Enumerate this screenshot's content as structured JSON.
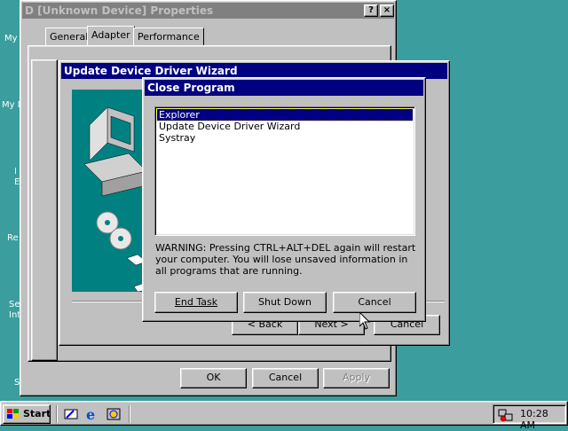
{
  "desktop": {
    "icon_labels": [
      "My",
      "My D",
      "I\nE",
      "Re",
      "Se\nInt",
      "S"
    ]
  },
  "properties_window": {
    "title": "D [Unknown Device] Properties",
    "help_button": "?",
    "close_button": "×",
    "tabs": [
      "General",
      "Adapter",
      "Performance"
    ],
    "ok_label": "OK",
    "cancel_label": "Cancel",
    "apply_label": "Apply"
  },
  "wizard_window": {
    "title": "Update Device Driver Wizard",
    "back_label": "< Back",
    "next_label": "Next >",
    "cancel_label": "Cancel"
  },
  "close_program": {
    "title": "Close Program",
    "tasks": [
      "Explorer",
      "Update Device Driver Wizard",
      "Systray"
    ],
    "selected_task": "Explorer",
    "warning": "WARNING: Pressing CTRL+ALT+DEL again will restart your computer. You will lose unsaved information in all programs that are running.",
    "end_task_label": "End Task",
    "shut_down_label": "Shut Down",
    "cancel_label": "Cancel"
  },
  "taskbar": {
    "start_label": "Start",
    "quicklaunch_icons": [
      "show-desktop-icon",
      "internet-explorer-icon",
      "channels-icon"
    ],
    "clock": "10:28 AM"
  }
}
